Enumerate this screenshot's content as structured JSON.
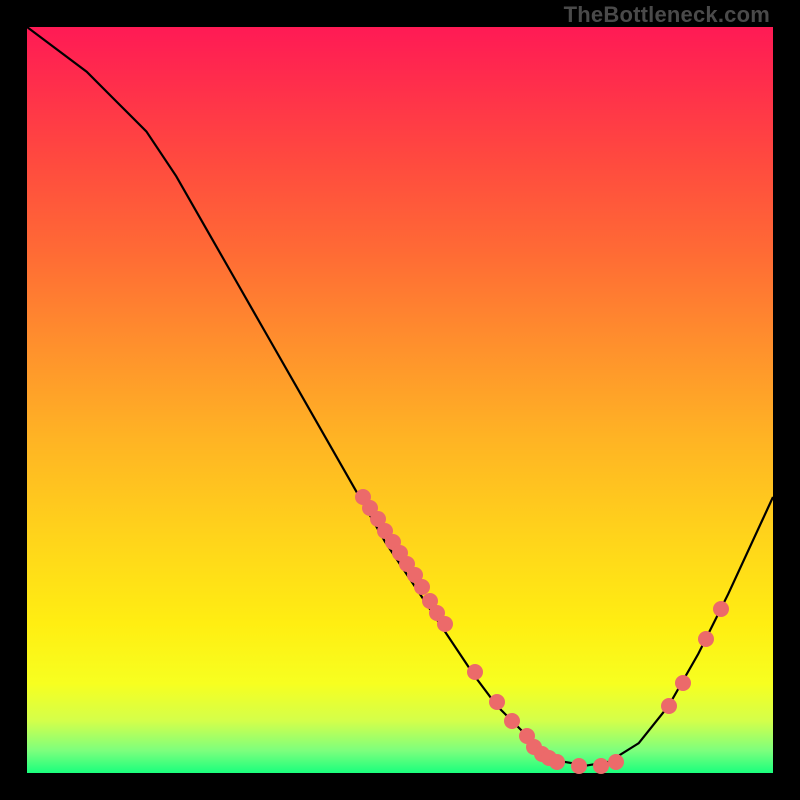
{
  "attribution": "TheBottleneck.com",
  "chart_data": {
    "type": "line",
    "title": "",
    "xlabel": "",
    "ylabel": "",
    "xlim": [
      0,
      100
    ],
    "ylim": [
      0,
      100
    ],
    "curve": {
      "x": [
        0,
        4,
        8,
        12,
        16,
        20,
        24,
        28,
        32,
        36,
        40,
        44,
        48,
        52,
        56,
        60,
        63,
        66,
        69,
        72,
        75,
        78,
        82,
        86,
        90,
        94,
        100
      ],
      "y": [
        100,
        97,
        94,
        90,
        86,
        80,
        73,
        66,
        59,
        52,
        45,
        38,
        31,
        25,
        19,
        13,
        9,
        6,
        3,
        1.5,
        1,
        1.5,
        4,
        9,
        16,
        24,
        37
      ]
    },
    "points": {
      "x": [
        45,
        46,
        47,
        48,
        49,
        50,
        51,
        52,
        53,
        54,
        55,
        56,
        60,
        63,
        65,
        67,
        68,
        69,
        70,
        71,
        74,
        77,
        79,
        86,
        88,
        91,
        93
      ],
      "y": [
        37,
        35.5,
        34,
        32.5,
        31,
        29.5,
        28,
        26.5,
        25,
        23,
        21.5,
        20,
        13.5,
        9.5,
        7,
        5,
        3.5,
        2.5,
        2,
        1.5,
        1,
        1,
        1.5,
        9,
        12,
        18,
        22
      ]
    },
    "colors": {
      "curve": "#000000",
      "points": "#ec6a6a"
    }
  }
}
